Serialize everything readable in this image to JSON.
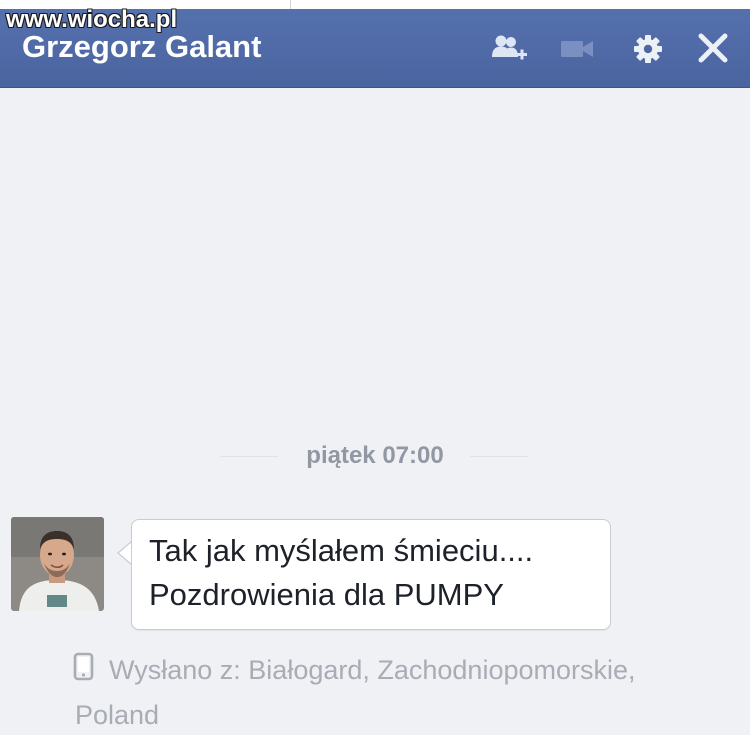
{
  "watermark": "www.wiocha.pl",
  "chat_header": {
    "contact_name": "Grzegorz Galant",
    "icons": [
      "add-friend-icon",
      "video-call-icon",
      "gear-icon",
      "close-icon"
    ],
    "background_color": "#4e67a4"
  },
  "conversation": {
    "timestamp": "piątek 07:00",
    "message": {
      "lines": [
        "Tak jak myślałem śmieciu....",
        "Pozdrowienia dla PUMPY"
      ]
    },
    "sent_from": {
      "icon": "mobile-phone-icon",
      "line1": "Wysłano z: Białogard, Zachodniopomorskie,",
      "line2": "Poland"
    }
  }
}
